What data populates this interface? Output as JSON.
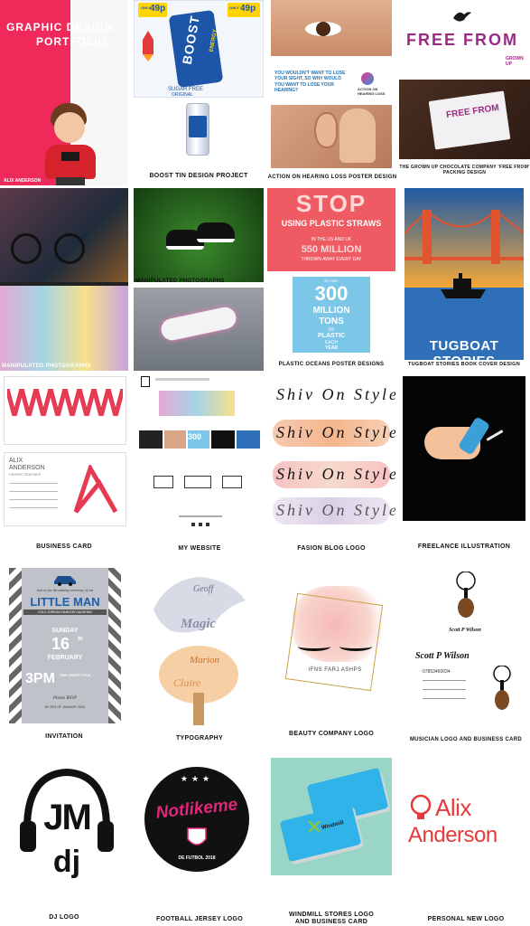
{
  "cover": {
    "title_line1": "GRAPHIC DESIGN",
    "title_line2": "PORTFOLIO.",
    "author_tag": "ALIX ANDERSON"
  },
  "boost": {
    "price_left": "49p",
    "price_right": "49p",
    "only_left": "ONLY",
    "only_right": "ONLY",
    "brand": "BOOST",
    "sub": "ENERGY",
    "sugar_free": "SUGAR FREE",
    "original": "ORIGINAL",
    "caption": "BOOST TIN DESIGN PROJECT"
  },
  "hearing": {
    "question": "YOU WOULDN'T WANT TO LOSE YOUR SIGHT, SO WHY WOULD YOU WANT TO LOSE YOUR HEARING?",
    "org": "ACTION ON HEARING LOSS",
    "caption": "ACTION ON HEARING LOSS POSTER DESIGN"
  },
  "freefrom": {
    "logo": "FREE FROM",
    "sub": "GROWN UP",
    "caption": "THE GROWN UP CHOCOLATE COMPANY 'FREE FROM' PACKING DESIGN"
  },
  "photos": {
    "caption_upper": "MANIPULATED PHOTOGRAPHS",
    "caption_lower": "MANIPULATED PHOTOGRAPHS"
  },
  "straws": {
    "stop": "STOP",
    "line": "USING PLASTIC STRAWS",
    "in_us": "IN THE US AND UK",
    "million": "550 MILLION",
    "thrown": "THROWN AWAY EVERY DAY",
    "by": "BY 2050",
    "num": "300",
    "million2": "MILLION",
    "tons": "TONS",
    "of": "OF",
    "plastic": "PLASTIC",
    "each": "EACH",
    "year": "YEAR",
    "caption": "PLASTIC OCEANS POSTER DESIGNS"
  },
  "tugboat": {
    "title": "TUGBOAT STORIES",
    "caption": "TUGBOAT STORIES BOOK COVER DESIGN"
  },
  "bizcard": {
    "name_line1": "ALIX",
    "name_line2": "ANDERSON",
    "role": "GRAPHIC DESIGNER",
    "caption": "BUSINESS CARD"
  },
  "website": {
    "stat": "300",
    "caption": "MY WEBSITE"
  },
  "fashion": {
    "logo": "Shiv On Style",
    "caption": "FASION BLOG LOGO"
  },
  "freelance": {
    "caption": "FREELANCE ILLUSTRATION"
  },
  "invitation": {
    "script_top": "Join us for the naming ceremony of our",
    "title": "LITTLE MAN",
    "name": "KOLE JORDAN HANNON GAUGHAN",
    "day": "SUNDAY",
    "date": "16",
    "date_sup": "th",
    "month": "FEBRUARY",
    "time": "3PM",
    "place": "THE CRAFTY FOX",
    "rsvp": "Please RSVP",
    "by": "BY 8TH OF JANUARY 2020",
    "caption": "INVITATION"
  },
  "typography": {
    "word1": "Magic",
    "word2": "Marion",
    "word3": "Claire",
    "word4": "Geoff",
    "caption": "TYPOGRAPHY"
  },
  "beauty": {
    "brand": "IFNS FARJ ASHPS",
    "caption": "BEAUTY COMPANY LOGO"
  },
  "musician": {
    "name": "Scott P Wilson",
    "phone": "07853460034",
    "caption": "MUSICIAN LOGO AND BUSINESS CARD"
  },
  "dj": {
    "letters": "JM",
    "sub": "dj",
    "caption": "DJ LOGO"
  },
  "football": {
    "word": "Notlikeme",
    "ribbon": "DE FUTBOL 2018",
    "caption": "FOOTBALL JERSEY LOGO"
  },
  "windmill": {
    "brand": "Windmill",
    "caption_line1": "WINDMILL STORES LOGO",
    "caption_line2": "AND BUSINESS CARD"
  },
  "personal": {
    "line1": "Alix",
    "line2": "Anderson",
    "caption": "PERSONAL NEW LOGO"
  },
  "colors": {
    "cover_pink": "#ef2a5a",
    "boost_blue": "#1d56a8",
    "straws_pink": "#ef5b63",
    "straws_blue": "#7cc7e8",
    "tug_blue": "#2e6fb7",
    "logo_red": "#e63a3a",
    "football_pink": "#e0257a"
  }
}
